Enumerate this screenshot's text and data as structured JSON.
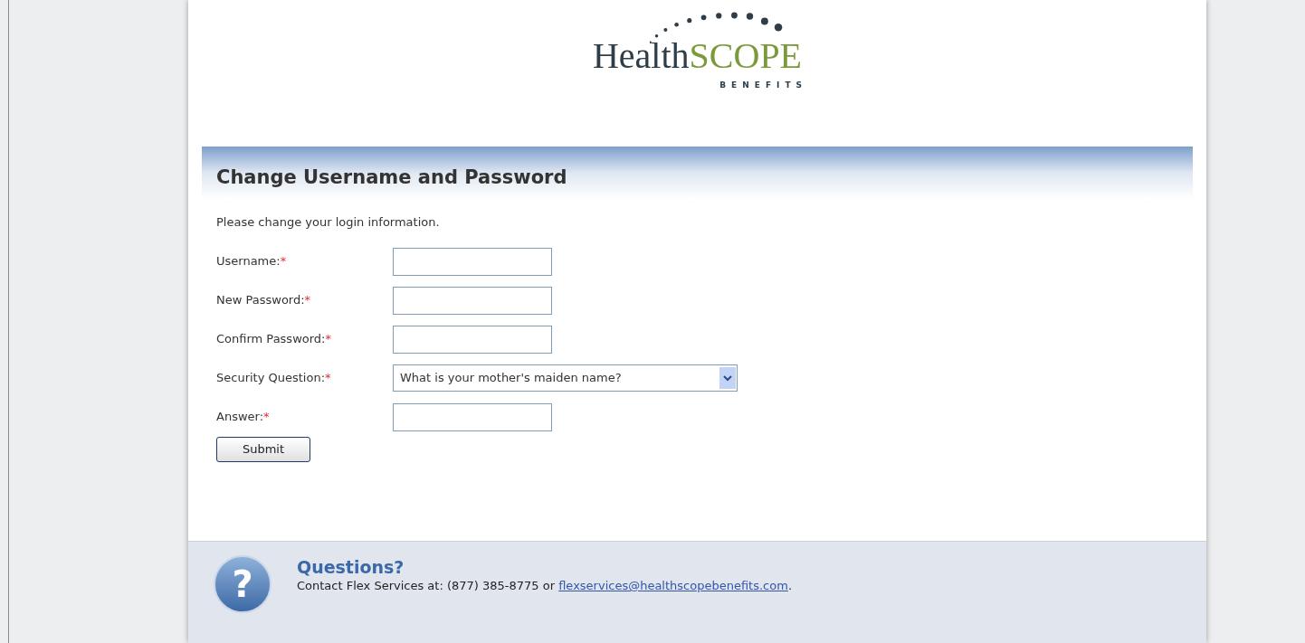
{
  "logo": {
    "word": "Health",
    "accent": "SCOPE",
    "tagline": "BENEFITS"
  },
  "form": {
    "title": "Change Username and Password",
    "intro": "Please change your login information.",
    "fields": [
      {
        "kind": "text",
        "label": "Username:",
        "required": true
      },
      {
        "kind": "text",
        "label": "New Password:",
        "required": true
      },
      {
        "kind": "text",
        "label": "Confirm Password:",
        "required": true
      },
      {
        "kind": "select",
        "label": "Security Question:",
        "required": true,
        "value": "What is your mother's maiden name?"
      },
      {
        "kind": "text",
        "label": "Answer:",
        "required": true
      }
    ],
    "required_mark": "*",
    "submit": "Submit"
  },
  "footer": {
    "icon_glyph": "?",
    "title": "Questions?",
    "text_before": "Contact Flex Services at: (877) 385-8775 or ",
    "link": "flexservices@healthscopebenefits.com",
    "text_after": "."
  }
}
